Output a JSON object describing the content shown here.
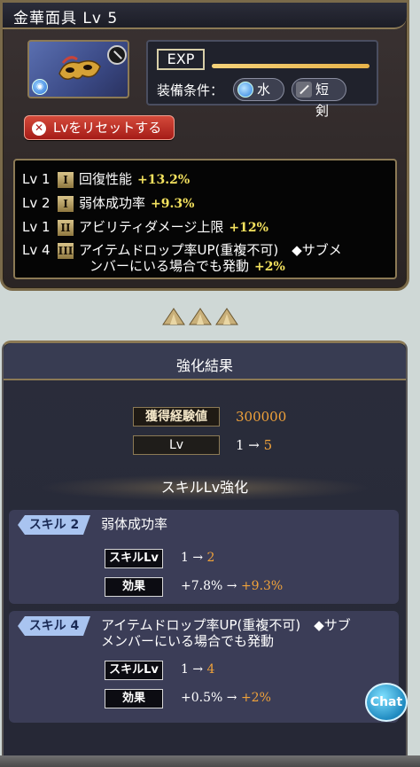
{
  "header": {
    "title": "金華面具 Lv 5"
  },
  "item": {
    "exp_label": "EXP",
    "equip_label": "装備条件：",
    "equip_tags": [
      "水",
      "短剣"
    ],
    "reset_button": "Lvをリセットする"
  },
  "skills": [
    {
      "lv": "Lv 1",
      "rank": "I",
      "name": "回復性能",
      "bonus": "+13.2%"
    },
    {
      "lv": "Lv 2",
      "rank": "I",
      "name": "弱体成功率",
      "bonus": "+9.3%"
    },
    {
      "lv": "Lv 1",
      "rank": "II",
      "name": "アビリティダメージ上限",
      "bonus": "+12%"
    },
    {
      "lv": "Lv 4",
      "rank": "III",
      "name": "アイテムドロップ率UP(重複不可)　◆サブメ",
      "name2": "ンバーにいる場合でも発動",
      "bonus": "+2%"
    }
  ],
  "result": {
    "title": "強化結果",
    "exp_label": "獲得経験値",
    "exp_value": "300000",
    "lv_label": "Lv",
    "lv_from": "1 →",
    "lv_to": "5",
    "skill_lv_title": "スキルLv強化"
  },
  "upgrades": [
    {
      "tag": "スキル 2",
      "name": "弱体成功率",
      "skilllv_label": "スキルLv",
      "skilllv_from": "1 →",
      "skilllv_to": "2",
      "effect_label": "効果",
      "effect_from": "+7.8% →",
      "effect_to": "+9.3%"
    },
    {
      "tag": "スキル 4",
      "name": "アイテムドロップ率UP(重複不可)　◆サブ",
      "name2": "メンバーにいる場合でも発動",
      "skilllv_label": "スキルLv",
      "skilllv_from": "1 →",
      "skilllv_to": "4",
      "effect_label": "効果",
      "effect_from": "+0.5% →",
      "effect_to": "+2%"
    }
  ],
  "chat": {
    "label": "Chat"
  }
}
